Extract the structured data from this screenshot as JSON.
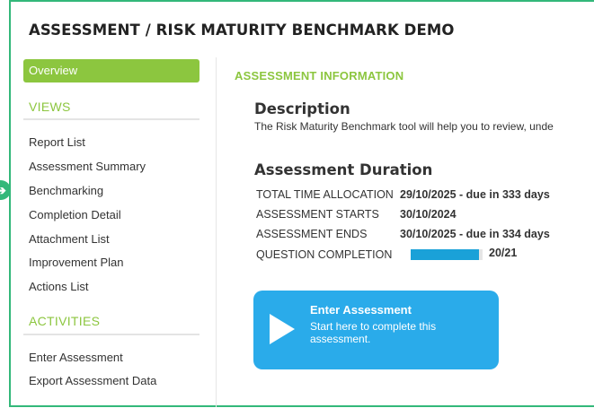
{
  "page": {
    "title": "ASSESSMENT / RISK MATURITY BENCHMARK DEMO"
  },
  "sidebar": {
    "overview_label": "Overview",
    "views_heading": "VIEWS",
    "views_items": [
      {
        "label": "Report List"
      },
      {
        "label": "Assessment Summary"
      },
      {
        "label": "Benchmarking"
      },
      {
        "label": "Completion Detail"
      },
      {
        "label": "Attachment List"
      },
      {
        "label": "Improvement Plan"
      },
      {
        "label": "Actions List"
      }
    ],
    "activities_heading": "ACTIVITIES",
    "activities_items": [
      {
        "label": "Enter Assessment"
      },
      {
        "label": "Export Assessment Data"
      }
    ],
    "current_pointer_icon": "arrow-right-circle-icon"
  },
  "main": {
    "section_heading": "ASSESSMENT INFORMATION",
    "description": {
      "title": "Description",
      "text": "The Risk Maturity Benchmark tool will help you to review, unde"
    },
    "duration": {
      "title": "Assessment Duration",
      "rows": [
        {
          "label": "TOTAL TIME ALLOCATION",
          "value": "29/10/2025 - due in 333 days"
        },
        {
          "label": "ASSESSMENT STARTS",
          "value": "30/10/2024"
        },
        {
          "label": "ASSESSMENT ENDS",
          "value": "30/10/2025 - due in 334 days"
        }
      ],
      "completion_label": "QUESTION COMPLETION",
      "completion_text": "20/21",
      "completion_fraction": 0.952
    },
    "enter_button": {
      "title": "Enter Assessment",
      "subtitle": "Start here to complete this assessment.",
      "icon": "play-icon"
    }
  },
  "colors": {
    "accent_green": "#8cc63f",
    "frame_green": "#33b87a",
    "button_blue": "#2aabea",
    "progress_blue": "#1aa1d8"
  }
}
